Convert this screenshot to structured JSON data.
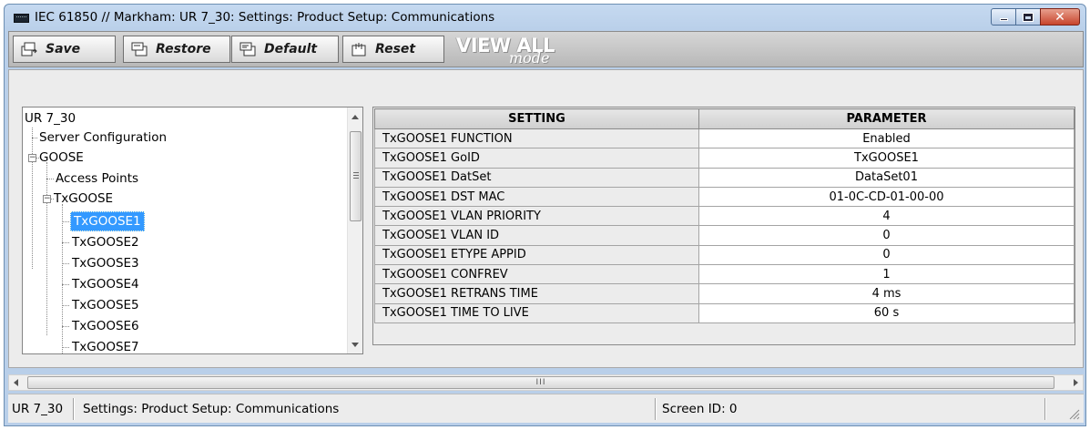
{
  "window": {
    "title": "IEC 61850 // Markham: UR 7_30: Settings: Product Setup: Communications",
    "close_glyph": "✕"
  },
  "toolbar": {
    "save_label": "Save",
    "restore_label": "Restore",
    "default_label": "Default",
    "reset_label": "Reset",
    "view_all": "VIEW ALL",
    "view_all_mode": "mode"
  },
  "tree": {
    "root": "UR 7_30",
    "items": [
      {
        "label": "Server Configuration"
      },
      {
        "label": "GOOSE"
      },
      {
        "label": "Access Points"
      },
      {
        "label": "TxGOOSE"
      },
      {
        "label": "TxGOOSE1"
      },
      {
        "label": "TxGOOSE2"
      },
      {
        "label": "TxGOOSE3"
      },
      {
        "label": "TxGOOSE4"
      },
      {
        "label": "TxGOOSE5"
      },
      {
        "label": "TxGOOSE6"
      },
      {
        "label": "TxGOOSE7"
      }
    ],
    "selected": "TxGOOSE1",
    "expanded_glyph": "−"
  },
  "grid": {
    "headers": [
      "SETTING",
      "PARAMETER"
    ],
    "rows": [
      {
        "setting": "TxGOOSE1 FUNCTION",
        "parameter": "Enabled"
      },
      {
        "setting": "TxGOOSE1 GoID",
        "parameter": "TxGOOSE1"
      },
      {
        "setting": "TxGOOSE1 DatSet",
        "parameter": "DataSet01"
      },
      {
        "setting": "TxGOOSE1 DST MAC",
        "parameter": "01-0C-CD-01-00-00"
      },
      {
        "setting": "TxGOOSE1 VLAN PRIORITY",
        "parameter": "4"
      },
      {
        "setting": "TxGOOSE1 VLAN ID",
        "parameter": "0"
      },
      {
        "setting": "TxGOOSE1 ETYPE APPID",
        "parameter": "0"
      },
      {
        "setting": "TxGOOSE1 CONFREV",
        "parameter": "1"
      },
      {
        "setting": "TxGOOSE1 RETRANS TIME",
        "parameter": "4 ms"
      },
      {
        "setting": "TxGOOSE1 TIME TO LIVE",
        "parameter": "60 s"
      }
    ]
  },
  "hscroll": {
    "thumb_grip": "III"
  },
  "status": {
    "device": "UR 7_30",
    "path": "Settings: Product Setup: Communications",
    "screen_id": "Screen ID: 0"
  },
  "icons": {
    "window_icon": "monitor-icon",
    "save": "save-icon",
    "restore": "restore-icon",
    "default": "default-icon",
    "reset": "reset-icon"
  },
  "colors": {
    "selection": "#3399ff",
    "close_button": "#c7442c",
    "title_bar": "#b9cfe9"
  }
}
